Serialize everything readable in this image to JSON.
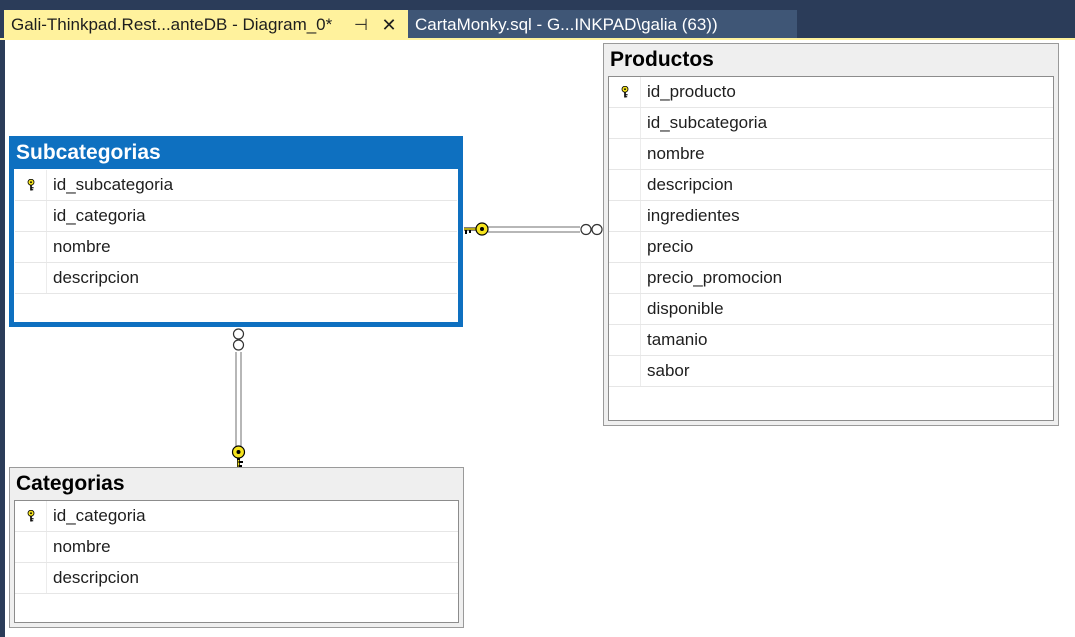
{
  "tabs": [
    {
      "label": "Gali-Thinkpad.Rest...anteDB - Diagram_0*",
      "active": true
    },
    {
      "label": "CartaMonky.sql - G...INKPAD\\galia (63))",
      "active": false
    }
  ],
  "tab_pin_glyph": "⊣",
  "tab_close_glyph": "✕",
  "colors": {
    "tabbar_bg": "#2b3c59",
    "active_tab_bg": "#fff29d",
    "selected_table_accent": "#0e70c0",
    "key_yellow": "#f5e31e"
  },
  "tables": {
    "subcategorias": {
      "title": "Subcategorias",
      "selected": true,
      "columns": [
        {
          "name": "id_subcategoria",
          "primary_key": true
        },
        {
          "name": "id_categoria",
          "primary_key": false
        },
        {
          "name": "nombre",
          "primary_key": false
        },
        {
          "name": "descripcion",
          "primary_key": false
        }
      ]
    },
    "productos": {
      "title": "Productos",
      "selected": false,
      "columns": [
        {
          "name": "id_producto",
          "primary_key": true
        },
        {
          "name": "id_subcategoria",
          "primary_key": false
        },
        {
          "name": "nombre",
          "primary_key": false
        },
        {
          "name": "descripcion",
          "primary_key": false
        },
        {
          "name": "ingredientes",
          "primary_key": false
        },
        {
          "name": "precio",
          "primary_key": false
        },
        {
          "name": "precio_promocion",
          "primary_key": false
        },
        {
          "name": "disponible",
          "primary_key": false
        },
        {
          "name": "tamanio",
          "primary_key": false
        },
        {
          "name": "sabor",
          "primary_key": false
        }
      ]
    },
    "categorias": {
      "title": "Categorias",
      "selected": false,
      "columns": [
        {
          "name": "id_categoria",
          "primary_key": true
        },
        {
          "name": "nombre",
          "primary_key": false
        },
        {
          "name": "descripcion",
          "primary_key": false
        }
      ]
    }
  },
  "relationships": [
    {
      "from": "Subcategorias",
      "from_end": "one-key",
      "to": "Productos",
      "to_end": "many-infinity"
    },
    {
      "from": "Categorias",
      "from_end": "one-key",
      "to": "Subcategorias",
      "to_end": "many-infinity"
    }
  ]
}
